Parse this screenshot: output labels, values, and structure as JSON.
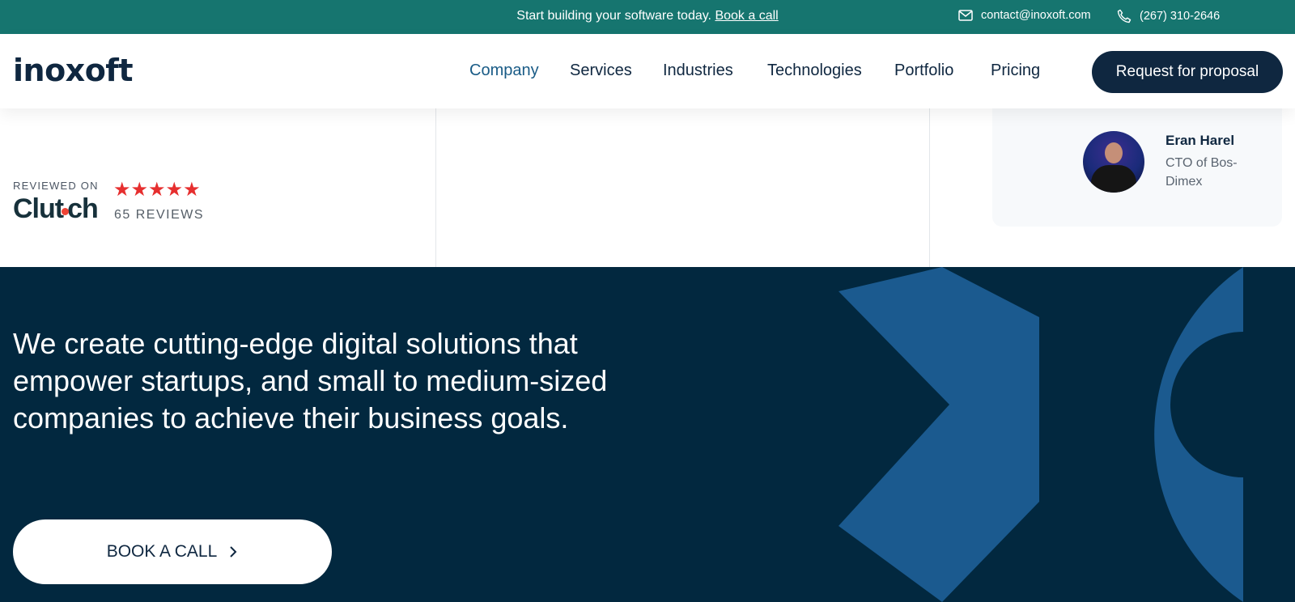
{
  "topbar": {
    "promo_text": "Start building your software today.",
    "promo_link": "Book a call",
    "email": "contact@inoxoft.com",
    "phone": "(267) 310-2646"
  },
  "header": {
    "logo": "inoxoft",
    "nav": [
      "Company",
      "Services",
      "Industries",
      "Technologies",
      "Portfolio",
      "Pricing"
    ],
    "active_nav": "Company",
    "cta": "Request for proposal"
  },
  "reviews": {
    "reviewed_on": "REVIEWED ON",
    "brand": "Clutch",
    "stars": 5,
    "count": "65 REVIEWS"
  },
  "testimonial": {
    "name": "Eran Harel",
    "role": "CTO of Bos-Dimex"
  },
  "hero": {
    "headline": "We create cutting-edge digital solutions that empower startups, and small to medium-sized companies to achieve their business goals.",
    "button": "BOOK A CALL"
  },
  "colors": {
    "topbar": "#16756f",
    "navy": "#0f2740",
    "hero_bg": "#02283f",
    "accent_blue": "#1b5a8f",
    "star_red": "#e62f2f"
  },
  "icons": {
    "email": "mail-icon",
    "phone": "phone-icon",
    "chevron": "chevron-right-icon"
  }
}
